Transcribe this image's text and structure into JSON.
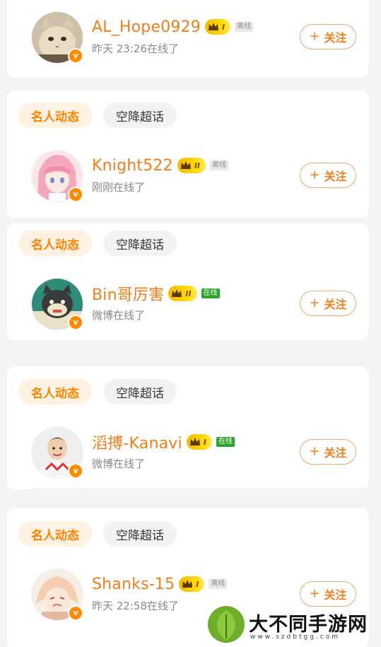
{
  "chips": {
    "primary": "名人动态",
    "secondary": "空降超话"
  },
  "follow_label": "关注",
  "users": [
    {
      "name": "AL_Hope0929",
      "level": "I",
      "status": "离线",
      "status_type": "offline",
      "subtitle": "昨天 23:26在线了"
    },
    {
      "name": "Knight522",
      "level": "II",
      "status": "离线",
      "status_type": "offline",
      "subtitle": "刚刚在线了"
    },
    {
      "name": "Bin哥厉害",
      "level": "II",
      "status": "在线",
      "status_type": "online",
      "subtitle": "微博在线了"
    },
    {
      "name": "滔搏-Kanavi",
      "level": "I",
      "status": "在线",
      "status_type": "online",
      "subtitle": "微博在线了"
    },
    {
      "name": "Shanks-15",
      "level": "I",
      "status": "离线",
      "status_type": "offline",
      "subtitle": "昨天 22:58在线了"
    }
  ],
  "watermark": {
    "text": "大不同手游网",
    "url": "www.szdbtgg.com"
  },
  "colors": {
    "accent": "#f47d19",
    "online": "#2ca42c",
    "verify": "#ff8a00"
  }
}
